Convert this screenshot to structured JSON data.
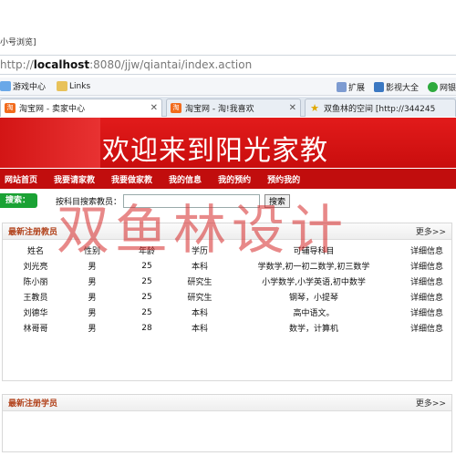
{
  "browser": {
    "window_title": "小号浏览]",
    "address": {
      "prefix": "http://",
      "host": "localhost",
      "rest": ":8080/jjw/qiantai/index.action"
    },
    "favorites": [
      {
        "label": "游戏中心",
        "icon": "game-icon"
      },
      {
        "label": "Links",
        "icon": "folder-icon"
      }
    ],
    "favorites_right": [
      {
        "label": "扩展",
        "icon": "extension-icon"
      },
      {
        "label": "影视大全",
        "icon": "video-icon"
      },
      {
        "label": "网银",
        "icon": "shield-icon"
      }
    ],
    "tabs": [
      {
        "label": "淘宝网 - 卖家中心",
        "icon_text": "淘"
      },
      {
        "label": "淘宝网 - 淘!我喜欢",
        "icon_text": "淘"
      },
      {
        "label": "双鱼林的空间 [http://344245",
        "icon_text": "★"
      }
    ]
  },
  "site": {
    "banner_title": "欢迎来到阳光家教",
    "nav": [
      "网站首页",
      "我要请家教",
      "我要做家教",
      "我的信息",
      "我的预约",
      "预约我的"
    ],
    "search": {
      "label": "搜索：",
      "prompt": "按科目搜索教员：",
      "button": "搜索",
      "value": ""
    },
    "watermark": "双鱼林设计"
  },
  "teachers_panel": {
    "title": "最新注册教员",
    "more": "更多>>",
    "columns": [
      "姓名",
      "性别",
      "年龄",
      "学历",
      "可辅导科目",
      "详细信息"
    ],
    "rows": [
      [
        "刘光亮",
        "男",
        "25",
        "本科",
        "学数学,初一初二数学,初三数学",
        "详细信息"
      ],
      [
        "陈小丽",
        "男",
        "25",
        "研究生",
        "小学数学,小学英语,初中数学",
        "详细信息"
      ],
      [
        "王教员",
        "男",
        "25",
        "研究生",
        "钢琴，小提琴",
        "详细信息"
      ],
      [
        "刘德华",
        "男",
        "25",
        "本科",
        "高中语文。",
        "详细信息"
      ],
      [
        "林哥哥",
        "男",
        "28",
        "本科",
        "数学，计算机",
        "详细信息"
      ]
    ]
  },
  "students_panel": {
    "title": "最新注册学员",
    "more": "更多>>"
  },
  "colors": {
    "banner_red": "#d11414",
    "nav_red": "#c10d0d",
    "search_green": "#1aa234",
    "panel_title": "#b1411a",
    "watermark": "#d62828"
  }
}
